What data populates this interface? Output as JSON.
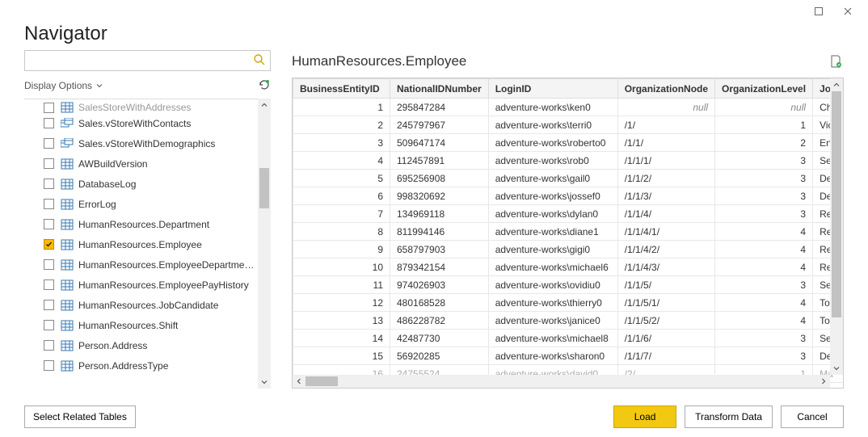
{
  "window": {
    "title": "Navigator",
    "maximize_glyph": "▢",
    "close_glyph": "✕"
  },
  "search": {
    "value": "",
    "placeholder": ""
  },
  "options": {
    "label": "Display Options"
  },
  "tree": {
    "cutoff_label": "SalesStoreWithAddresses",
    "items": [
      {
        "label": "Sales.vStoreWithContacts",
        "checked": false,
        "icon": "view"
      },
      {
        "label": "Sales.vStoreWithDemographics",
        "checked": false,
        "icon": "view"
      },
      {
        "label": "AWBuildVersion",
        "checked": false,
        "icon": "table"
      },
      {
        "label": "DatabaseLog",
        "checked": false,
        "icon": "table"
      },
      {
        "label": "ErrorLog",
        "checked": false,
        "icon": "table"
      },
      {
        "label": "HumanResources.Department",
        "checked": false,
        "icon": "table"
      },
      {
        "label": "HumanResources.Employee",
        "checked": true,
        "icon": "table"
      },
      {
        "label": "HumanResources.EmployeeDepartmen...",
        "checked": false,
        "icon": "table"
      },
      {
        "label": "HumanResources.EmployeePayHistory",
        "checked": false,
        "icon": "table"
      },
      {
        "label": "HumanResources.JobCandidate",
        "checked": false,
        "icon": "table"
      },
      {
        "label": "HumanResources.Shift",
        "checked": false,
        "icon": "table"
      },
      {
        "label": "Person.Address",
        "checked": false,
        "icon": "table"
      },
      {
        "label": "Person.AddressType",
        "checked": false,
        "icon": "table"
      }
    ]
  },
  "preview": {
    "title": "HumanResources.Employee",
    "columns": [
      "BusinessEntityID",
      "NationalIDNumber",
      "LoginID",
      "OrganizationNode",
      "OrganizationLevel",
      "JobTitle"
    ],
    "rows": [
      {
        "be": "1",
        "nid": "295847284",
        "login": "adventure-works\\ken0",
        "org": "null",
        "lvl": "null",
        "job": "Chie"
      },
      {
        "be": "2",
        "nid": "245797967",
        "login": "adventure-works\\terri0",
        "org": "/1/",
        "lvl": "1",
        "job": "Vice"
      },
      {
        "be": "3",
        "nid": "509647174",
        "login": "adventure-works\\roberto0",
        "org": "/1/1/",
        "lvl": "2",
        "job": "Eng"
      },
      {
        "be": "4",
        "nid": "112457891",
        "login": "adventure-works\\rob0",
        "org": "/1/1/1/",
        "lvl": "3",
        "job": "Sen"
      },
      {
        "be": "5",
        "nid": "695256908",
        "login": "adventure-works\\gail0",
        "org": "/1/1/2/",
        "lvl": "3",
        "job": "Des"
      },
      {
        "be": "6",
        "nid": "998320692",
        "login": "adventure-works\\jossef0",
        "org": "/1/1/3/",
        "lvl": "3",
        "job": "Des"
      },
      {
        "be": "7",
        "nid": "134969118",
        "login": "adventure-works\\dylan0",
        "org": "/1/1/4/",
        "lvl": "3",
        "job": "Res"
      },
      {
        "be": "8",
        "nid": "811994146",
        "login": "adventure-works\\diane1",
        "org": "/1/1/4/1/",
        "lvl": "4",
        "job": "Res"
      },
      {
        "be": "9",
        "nid": "658797903",
        "login": "adventure-works\\gigi0",
        "org": "/1/1/4/2/",
        "lvl": "4",
        "job": "Res"
      },
      {
        "be": "10",
        "nid": "879342154",
        "login": "adventure-works\\michael6",
        "org": "/1/1/4/3/",
        "lvl": "4",
        "job": "Res"
      },
      {
        "be": "11",
        "nid": "974026903",
        "login": "adventure-works\\ovidiu0",
        "org": "/1/1/5/",
        "lvl": "3",
        "job": "Sen"
      },
      {
        "be": "12",
        "nid": "480168528",
        "login": "adventure-works\\thierry0",
        "org": "/1/1/5/1/",
        "lvl": "4",
        "job": "Too"
      },
      {
        "be": "13",
        "nid": "486228782",
        "login": "adventure-works\\janice0",
        "org": "/1/1/5/2/",
        "lvl": "4",
        "job": "Too"
      },
      {
        "be": "14",
        "nid": "42487730",
        "login": "adventure-works\\michael8",
        "org": "/1/1/6/",
        "lvl": "3",
        "job": "Sen"
      },
      {
        "be": "15",
        "nid": "56920285",
        "login": "adventure-works\\sharon0",
        "org": "/1/1/7/",
        "lvl": "3",
        "job": "Des"
      }
    ],
    "faded_row": {
      "be": "16",
      "nid": "24755524",
      "login": "adventure-works\\david0",
      "org": "/2/",
      "lvl": "1",
      "job": "Ma"
    }
  },
  "footer": {
    "select_related": "Select Related Tables",
    "load": "Load",
    "transform": "Transform Data",
    "cancel": "Cancel"
  }
}
